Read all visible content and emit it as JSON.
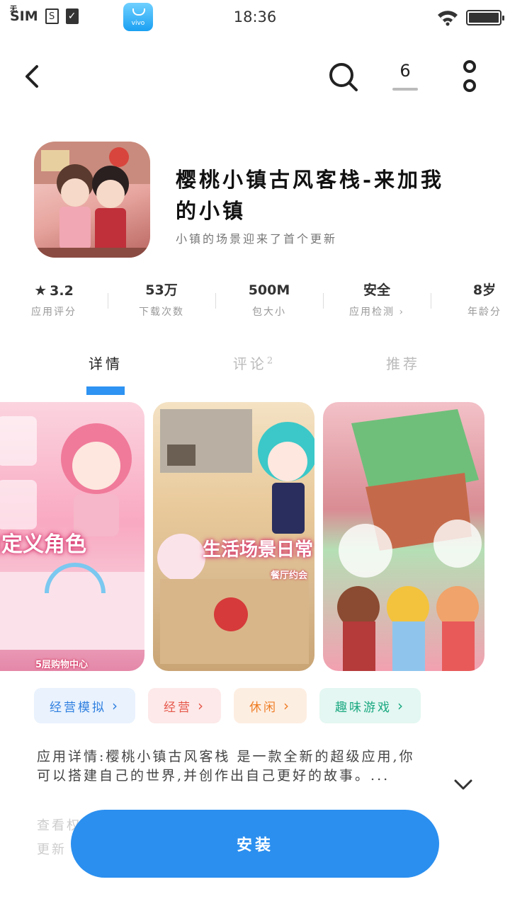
{
  "status_bar": {
    "carrier": "SIM",
    "no_sim_marker": "无",
    "store_badge": "vivo",
    "time": "18:36"
  },
  "toolbar": {
    "download_count": "6"
  },
  "app": {
    "title_line1": "樱桃小镇古风客栈-来加我",
    "title_line2": "的小镇",
    "subtitle": "小镇的场景迎来了首个更新"
  },
  "stats": [
    {
      "value": "3.2",
      "label": "应用评分"
    },
    {
      "value": "53万",
      "label": "下载次数"
    },
    {
      "value": "500M",
      "label": "包大小"
    },
    {
      "value": "安全",
      "label": "应用检测"
    },
    {
      "value": "8岁",
      "label": "年龄分"
    }
  ],
  "tabs": [
    {
      "label": "详情",
      "badge": ""
    },
    {
      "label": "评论",
      "badge": "2"
    },
    {
      "label": "推荐",
      "badge": ""
    }
  ],
  "screenshots": [
    {
      "caption": "自定义角色",
      "sub": "5层购物中心"
    },
    {
      "caption": "生活场景日常",
      "sub": "餐厅约会"
    },
    {
      "caption": "",
      "sub": ""
    }
  ],
  "tags": [
    "经营模拟",
    "经营",
    "休闲",
    "趣味游戏"
  ],
  "description": {
    "line1": "应用详情:樱桃小镇古风客栈 是一款全新的超级应用,你",
    "line2": "可以搭建自己的世界,并创作出自己更好的故事。..."
  },
  "faded": {
    "line1": "查看权",
    "line2": "更新"
  },
  "install_button": {
    "label": "安装"
  }
}
